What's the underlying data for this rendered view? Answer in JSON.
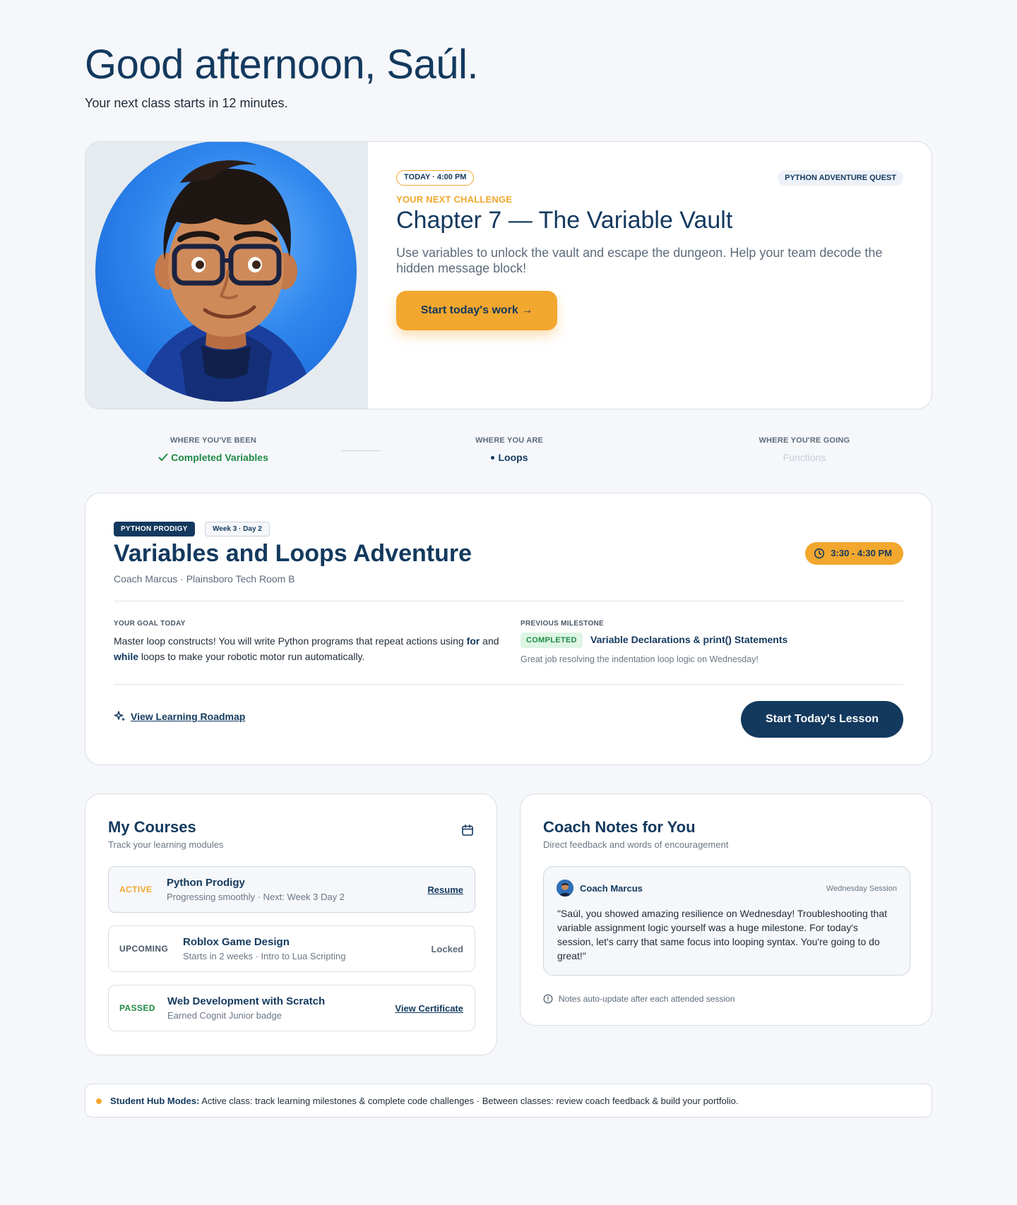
{
  "header": {
    "greeting": "Good afternoon, Saúl.",
    "subtitle": "Your next class starts in 12 minutes."
  },
  "hero": {
    "time_pill": "TODAY · 4:00 PM",
    "quest_pill": "PYTHON ADVENTURE QUEST",
    "eyebrow": "YOUR NEXT CHALLENGE",
    "title": "Chapter 7 — The Variable Vault",
    "description": "Use variables to unlock the vault and escape the dungeon. Help your team decode the hidden message block!",
    "button_label": "Start today's work →"
  },
  "progress": {
    "been_label": "WHERE YOU'VE BEEN",
    "been_value": "Completed Variables",
    "are_label": "WHERE YOU ARE",
    "are_value": "Loops",
    "going_label": "WHERE YOU'RE GOING",
    "going_value": "Functions"
  },
  "lesson": {
    "tag_course": "PYTHON PRODIGY",
    "tag_week": "Week 3 · Day 2",
    "title": "Variables and Loops Adventure",
    "meta": "Coach Marcus · Plainsboro Tech Room B",
    "time": "3:30 - 4:30 PM",
    "goal_label": "YOUR GOAL TODAY",
    "goal_text_1": "Master loop constructs! You will write Python programs that repeat actions using ",
    "goal_for": "for",
    "goal_and": " and ",
    "goal_while": "while",
    "goal_text_2": " loops to make your robotic motor run automatically.",
    "milestone_label": "PREVIOUS MILESTONE",
    "milestone_badge": "COMPLETED",
    "milestone_title": "Variable Declarations & print() Statements",
    "milestone_note": "Great job resolving the indentation loop logic on Wednesday!",
    "roadmap_link": "View Learning Roadmap",
    "start_button": "Start Today's Lesson"
  },
  "courses": {
    "title": "My Courses",
    "subtitle": "Track your learning modules",
    "items": [
      {
        "status": "ACTIVE",
        "status_color": "#f2a72e",
        "name": "Python Prodigy",
        "desc": "Progressing smoothly · Next: Week 3 Day 2",
        "action": "Resume"
      },
      {
        "status": "UPCOMING",
        "status_color": "#4a5766",
        "name": "Roblox Game Design",
        "desc": "Starts in 2 weeks · Intro to Lua Scripting",
        "action": "Locked"
      },
      {
        "status": "PASSED",
        "status_color": "#1f8a45",
        "name": "Web Development with Scratch",
        "desc": "Earned Cognit Junior badge",
        "action": "View Certificate"
      }
    ]
  },
  "coach_notes": {
    "title": "Coach Notes for You",
    "subtitle": "Direct feedback and words of encouragement",
    "coach_name": "Coach Marcus",
    "session": "Wednesday Session",
    "note": "\"Saúl, you showed amazing resilience on Wednesday! Troubleshooting that variable assignment logic yourself was a huge milestone. For today's session, let's carry that same focus into looping syntax. You're going to do great!\"",
    "footer": "Notes auto-update after each attended session"
  },
  "modes": {
    "label": "Student Hub Modes:",
    "text": " Active class: track learning milestones & complete code challenges · Between classes: review coach feedback & build your portfolio."
  },
  "colors": {
    "navy": "#13395e",
    "accent": "#f2a72e",
    "success": "#1f8a45",
    "background": "#f5f7fa"
  }
}
